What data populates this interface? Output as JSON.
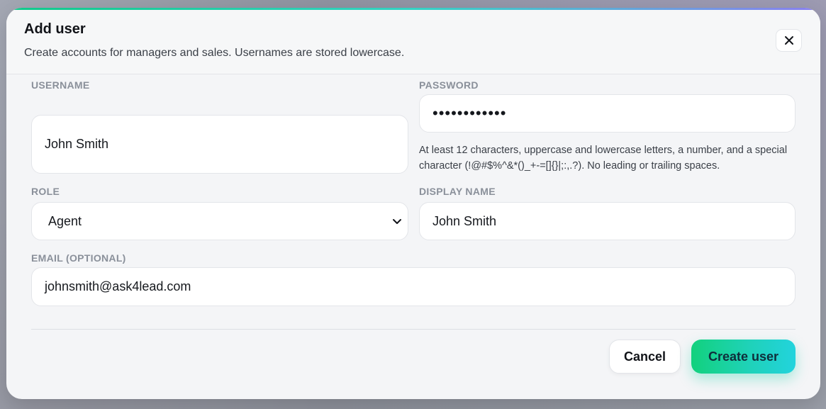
{
  "modal": {
    "title": "Add user",
    "subtitle": "Create accounts for managers and sales. Usernames are stored lowercase.",
    "close_icon": "close-icon",
    "accent_colors": [
      "#10c98a",
      "#34d3c4",
      "#8a7ff0"
    ]
  },
  "form": {
    "username": {
      "label": "USERNAME",
      "value": "John Smith"
    },
    "password": {
      "label": "PASSWORD",
      "value": "••••••••••••",
      "hint": "At least 12 characters, uppercase and lowercase letters, a number, and a special character (!@#$%^&*()_+-=[]{}|;:,.?). No leading or trailing spaces."
    },
    "role": {
      "label": "ROLE",
      "value": "Agent",
      "icon": "chevron-down-icon"
    },
    "display_name": {
      "label": "DISPLAY NAME",
      "value": "John Smith"
    },
    "email": {
      "label": "EMAIL (OPTIONAL)",
      "value": "johnsmith@ask4lead.com"
    }
  },
  "actions": {
    "cancel_label": "Cancel",
    "create_label": "Create user",
    "create_colors": [
      "#12d17d",
      "#22d3dd"
    ]
  }
}
